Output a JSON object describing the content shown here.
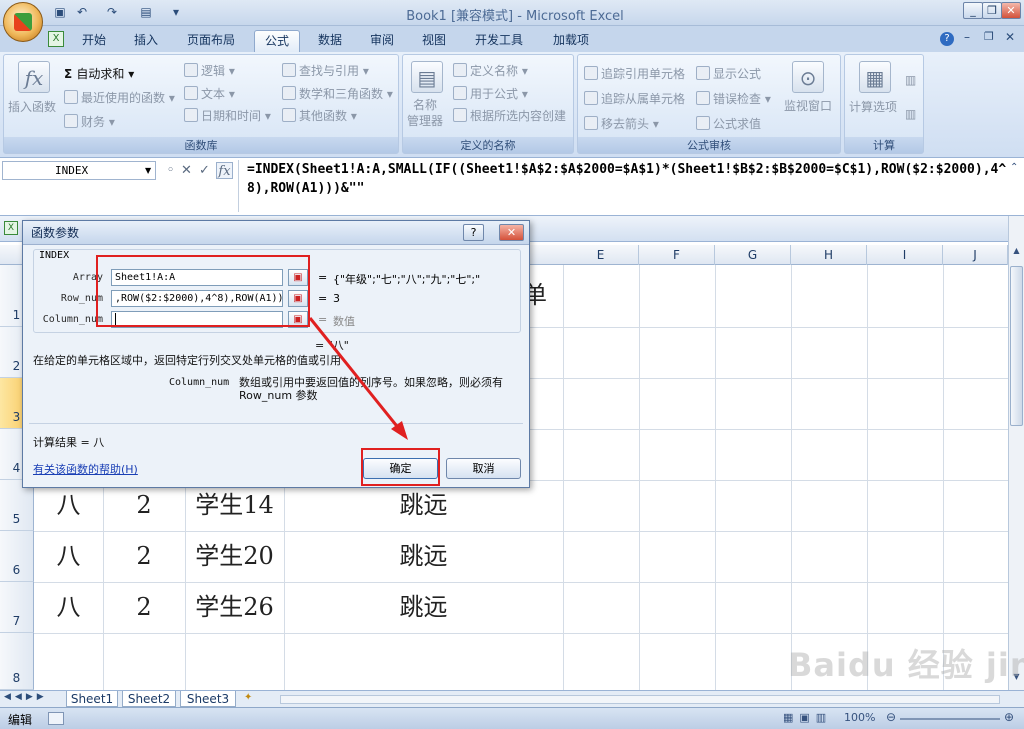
{
  "window": {
    "title": "Book1  [兼容模式] - Microsoft Excel"
  },
  "tabs": [
    "开始",
    "插入",
    "页面布局",
    "公式",
    "数据",
    "审阅",
    "视图",
    "开发工具",
    "加载项"
  ],
  "ribbon": {
    "insert_function": "插入函数",
    "autosum": "自动求和",
    "recent": "最近使用的函数",
    "financial": "财务",
    "logical": "逻辑",
    "text": "文本",
    "datetime": "日期和时间",
    "lookup": "查找与引用",
    "math": "数学和三角函数",
    "other": "其他函数",
    "group_library": "函数库",
    "name_manager": "名称\n管理器",
    "define_name": "定义名称",
    "use_in_formula": "用于公式",
    "create_from_selection": "根据所选内容创建",
    "group_names": "定义的名称",
    "trace_precedents": "追踪引用单元格",
    "trace_dependents": "追踪从属单元格",
    "remove_arrows": "移去箭头",
    "show_formulas": "显示公式",
    "error_checking": "错误检查",
    "evaluate_formula": "公式求值",
    "watch_window": "监视窗口",
    "group_auditing": "公式审核",
    "calc_options": "计算选项",
    "group_calc": "计算"
  },
  "formula_bar": {
    "name_box": "INDEX",
    "formula": "=INDEX(Sheet1!A:A,SMALL(IF((Sheet1!$A$2:$A$2000=$A$1)*(Sheet1!$B$2:$B$2000=$C$1),ROW($2:$2000),4^8),ROW(A1)))&\"\""
  },
  "columns": [
    "E",
    "F",
    "G",
    "H",
    "I",
    "J"
  ],
  "rows": [
    "1",
    "2",
    "3",
    "4",
    "5",
    "6",
    "7",
    "8"
  ],
  "cells": {
    "r1_partial": "单",
    "r5": [
      "八",
      "2",
      "学生14",
      "跳远"
    ],
    "r6": [
      "八",
      "2",
      "学生20",
      "跳远"
    ],
    "r7": [
      "八",
      "2",
      "学生26",
      "跳远"
    ]
  },
  "dialog": {
    "title": "函数参数",
    "function_name": "INDEX",
    "params": [
      {
        "label": "Array",
        "value": "Sheet1!A:A",
        "result": "{\"年级\";\"七\";\"八\";\"九\";\"七\";\"",
        "eq": "="
      },
      {
        "label": "Row_num",
        "value": ",ROW($2:$2000),4^8),ROW(A1))",
        "result": "3",
        "eq": "="
      },
      {
        "label": "Column_num",
        "value": "",
        "result": "数值",
        "eq": "="
      }
    ],
    "formula_result_line": "= \"八\"",
    "description": "在给定的单元格区域中，返回特定行列交叉处单元格的值或引用",
    "param_help_name": "Column_num",
    "param_help_text": "数组或引用中要返回值的列序号。如果忽略，则必须有 Row_num 参数",
    "calc_result": "计算结果 = 八",
    "help_link": "有关该函数的帮助(H)",
    "ok": "确定",
    "cancel": "取消"
  },
  "sheets": [
    "Sheet1",
    "Sheet2",
    "Sheet3"
  ],
  "status": {
    "mode": "编辑",
    "zoom": "100%"
  },
  "watermark": "Baidu 经验 jingyan.baidu.com"
}
